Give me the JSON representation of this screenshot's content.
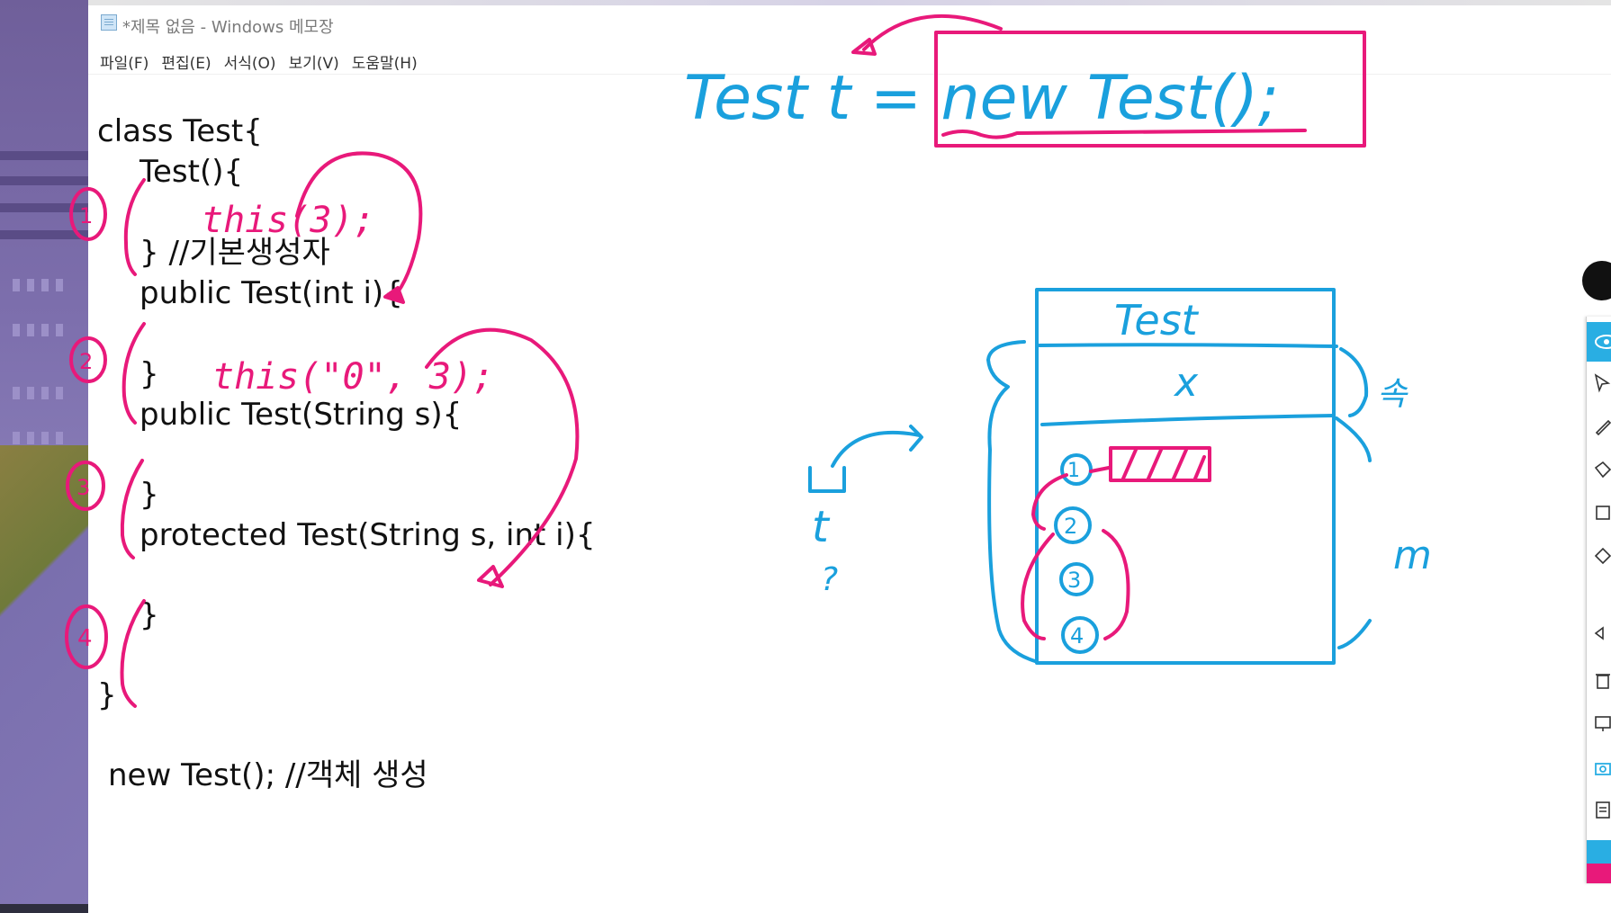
{
  "window": {
    "title": "*제목 없음 - Windows 메모장",
    "menu": [
      "파일(F)",
      "편집(E)",
      "서식(O)",
      "보기(V)",
      "도움말(H)"
    ]
  },
  "editor": {
    "lines": [
      "class Test{",
      "Test(){",
      "} //기본생성자",
      "public Test(int i){",
      "}",
      "public Test(String s){",
      "}",
      "protected Test(String s, int i){",
      "}",
      "}",
      "new Test(); //객체 생성"
    ]
  },
  "annotations": {
    "this_call_1": "this(3);",
    "this_call_2": "this(\"0\", 3);",
    "markers": [
      "1",
      "2",
      "3",
      "4"
    ],
    "statement": "Test t = new Test();",
    "box_title": "Test",
    "field": "x",
    "var_label": "t",
    "left_note": "?",
    "right_note_top": "속",
    "right_note_bottom": "m"
  },
  "colors": {
    "pink": "#e8197a",
    "blue": "#1aa0dd",
    "toolbar_active": "#29aee3"
  },
  "toolbar": {
    "tools": [
      "eye-icon",
      "pointer-icon",
      "pen-icon",
      "highlighter-icon",
      "eraser-icon",
      "shape-icon",
      "undo-icon",
      "trash-icon",
      "screen-icon",
      "camera-icon",
      "clipboard-icon"
    ],
    "swatches": [
      "#29aee3",
      "#e8197a"
    ]
  }
}
